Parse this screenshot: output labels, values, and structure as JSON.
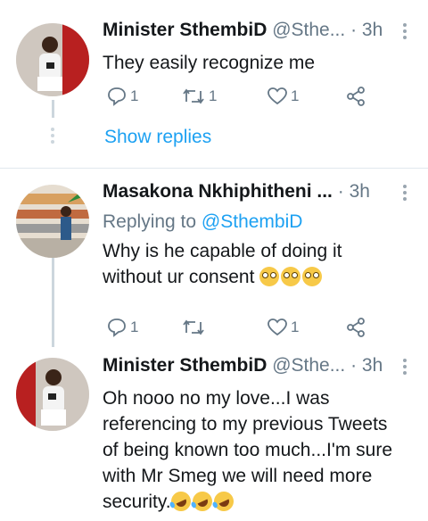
{
  "tweets": [
    {
      "name": "Minister SthembiD",
      "handle": "@Sthe...",
      "separator": "·",
      "time": "3h",
      "text": "They easily recognize me",
      "replies": "1",
      "retweets": "1",
      "likes": "1"
    },
    {
      "name": "Masakona Nkhiphitheni ...",
      "separator": "·",
      "time": "3h",
      "replying_label": "Replying to",
      "replying_to": "@SthembiD",
      "text_line1": "Why is he capable of doing it",
      "text_line2": "without ur consent",
      "emoji_name": "flushed-face",
      "replies": "1",
      "likes": "1"
    },
    {
      "name": "Minister SthembiD",
      "handle": "@Sthe...",
      "separator": "·",
      "time": "3h",
      "lines": [
        "Oh nooo no my love...I was",
        "referencing to my previous Tweets",
        "of being known too much...I'm sure",
        "with Mr Smeg we will need more",
        "security."
      ],
      "emoji_name": "rolling-on-floor-laughing"
    }
  ],
  "show_replies": "Show replies",
  "colors": {
    "link": "#1da1f2",
    "secondary": "#657786",
    "text": "#14171a",
    "line": "#ccd6dd"
  }
}
